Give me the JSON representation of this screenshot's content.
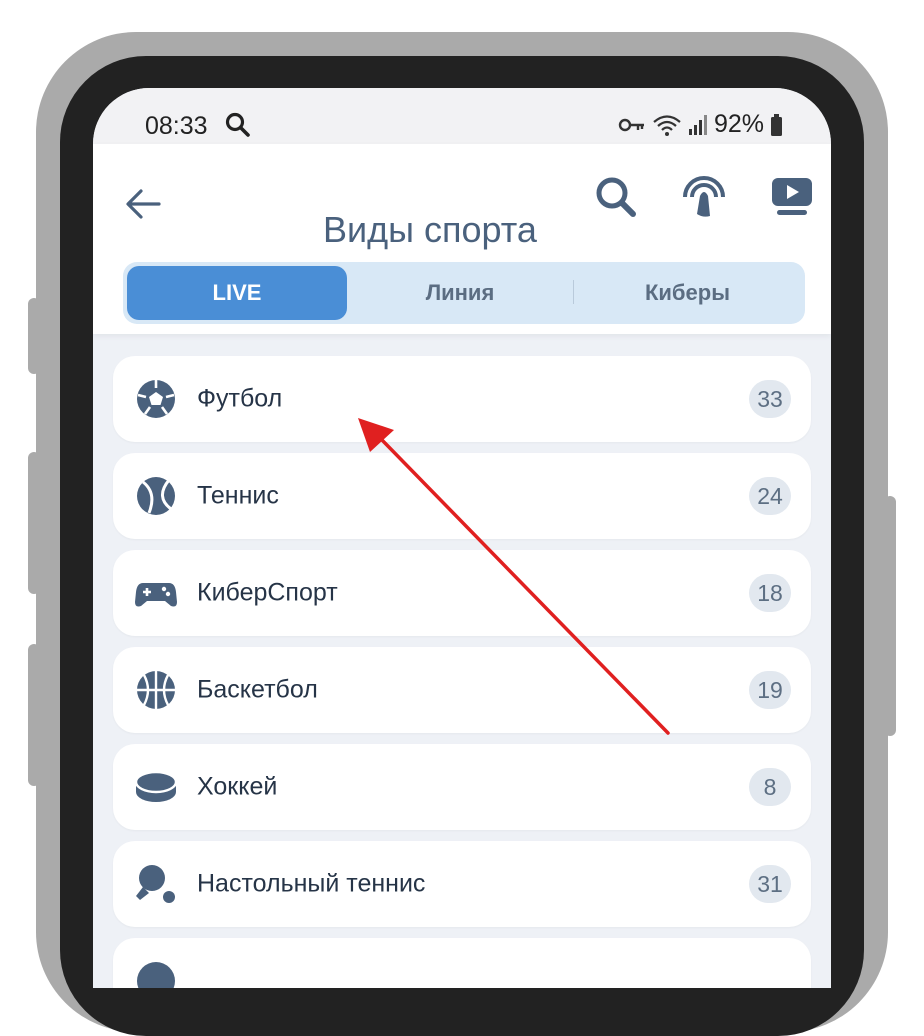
{
  "status_bar": {
    "time": "08:33",
    "battery": "92%"
  },
  "header": {
    "title": "Виды спорта"
  },
  "tabs": [
    {
      "label": "LIVE",
      "active": true
    },
    {
      "label": "Линия",
      "active": false
    },
    {
      "label": "Киберы",
      "active": false
    }
  ],
  "sports": [
    {
      "label": "Футбол",
      "count": "33",
      "icon": "soccer-ball-icon"
    },
    {
      "label": "Теннис",
      "count": "24",
      "icon": "tennis-ball-icon"
    },
    {
      "label": "КиберСпорт",
      "count": "18",
      "icon": "gamepad-icon"
    },
    {
      "label": "Баскетбол",
      "count": "19",
      "icon": "basketball-icon"
    },
    {
      "label": "Хоккей",
      "count": "8",
      "icon": "hockey-puck-icon"
    },
    {
      "label": "Настольный теннис",
      "count": "31",
      "icon": "ping-pong-icon"
    }
  ],
  "colors": {
    "accent": "#4a8ed6",
    "icon": "#4a617d",
    "annotation_arrow": "#e02020"
  }
}
